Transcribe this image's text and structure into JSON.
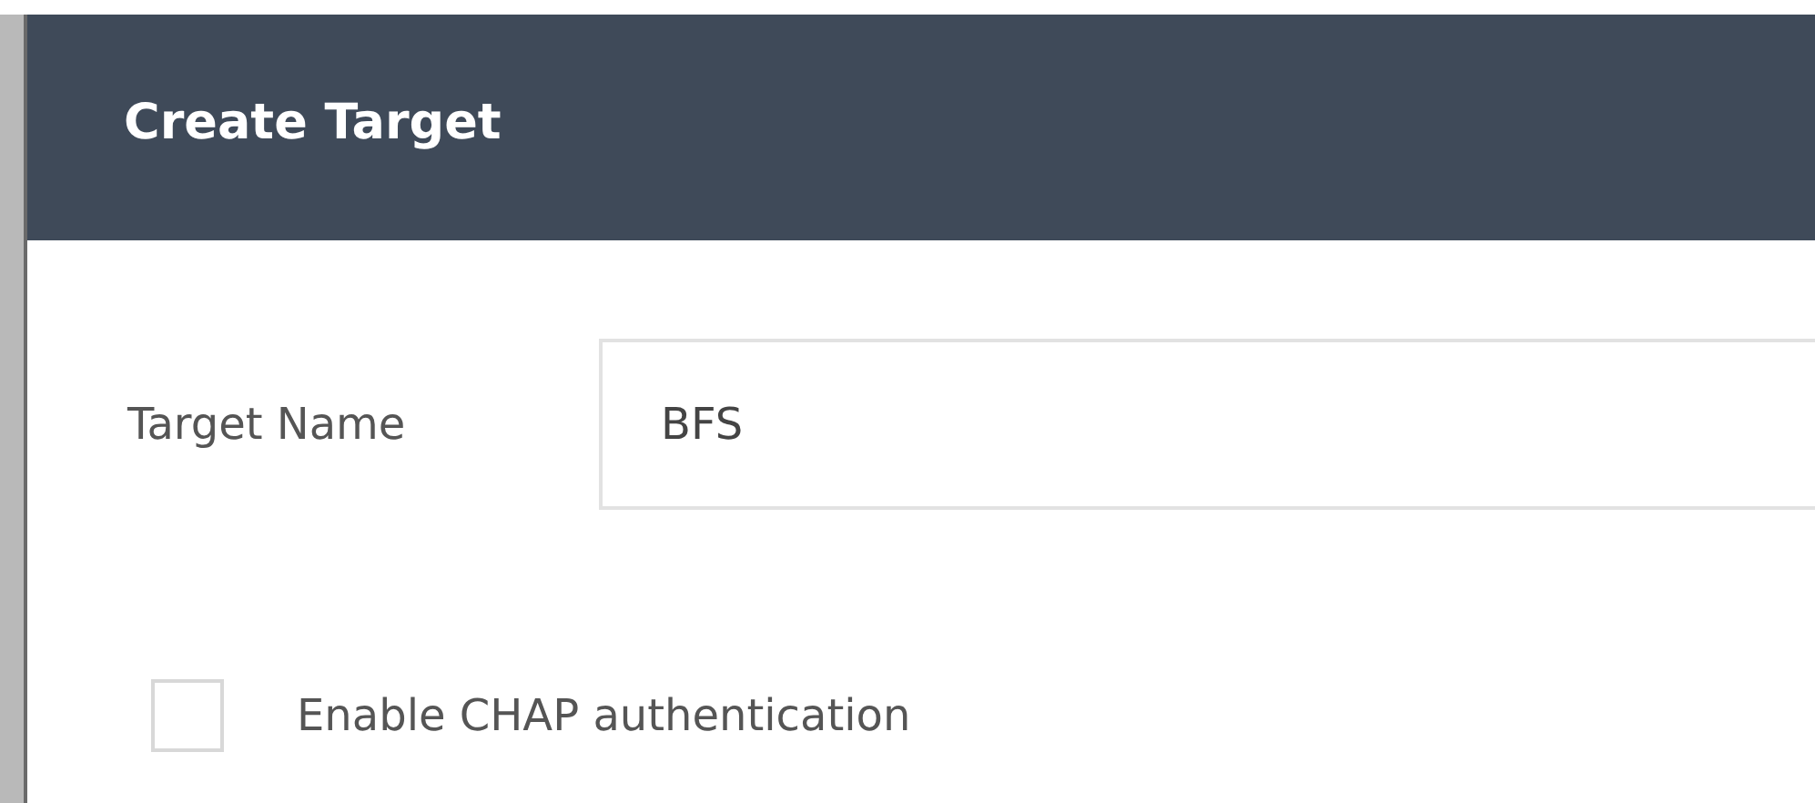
{
  "dialog": {
    "title": "Create Target"
  },
  "fields": [
    {
      "label": "Target Name",
      "value": "BFS"
    }
  ],
  "options": [
    {
      "kind": "checkbox",
      "label": "Enable CHAP authentication",
      "checked": false
    }
  ]
}
